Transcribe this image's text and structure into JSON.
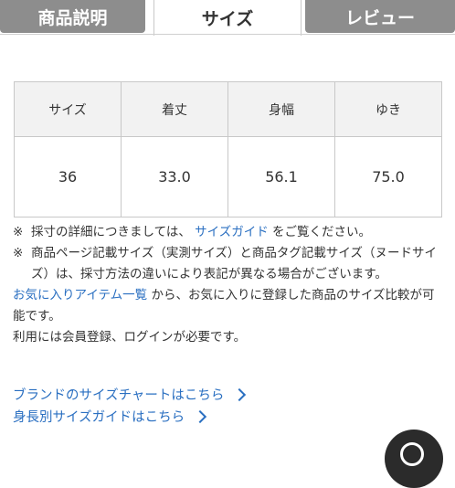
{
  "tabs": [
    {
      "label": "商品説明",
      "active": false
    },
    {
      "label": "サイズ",
      "active": true
    },
    {
      "label": "レビュー",
      "active": false
    }
  ],
  "size_table": {
    "headers": [
      "サイズ",
      "着丈",
      "身幅",
      "ゆき"
    ],
    "row": [
      "36",
      "33.0",
      "56.1",
      "75.0"
    ]
  },
  "notes": {
    "note1_mark": "※",
    "note1_before": "採寸の詳細につきましては、",
    "note1_link": "サイズガイド",
    "note1_after": "をご覧ください。",
    "note2_mark": "※",
    "note2_text": "商品ページ記載サイズ（実測サイズ）と商品タグ記載サイズ（ヌードサイズ）は、採寸方法の違いにより表記が異なる場合がございます。",
    "fav_link": "お気に入りアイテム一覧",
    "fav_text": "から、お気に入りに登録した商品のサイズ比較が可能です。",
    "login_text": "利用には会員登録、ログインが必要です。"
  },
  "links": {
    "brand_chart": "ブランドのサイズチャートはこちら",
    "height_guide": "身長別サイズガイドはこちら"
  },
  "colors": {
    "link": "#2a6fc1",
    "tab_inactive": "#8d8d8d"
  }
}
